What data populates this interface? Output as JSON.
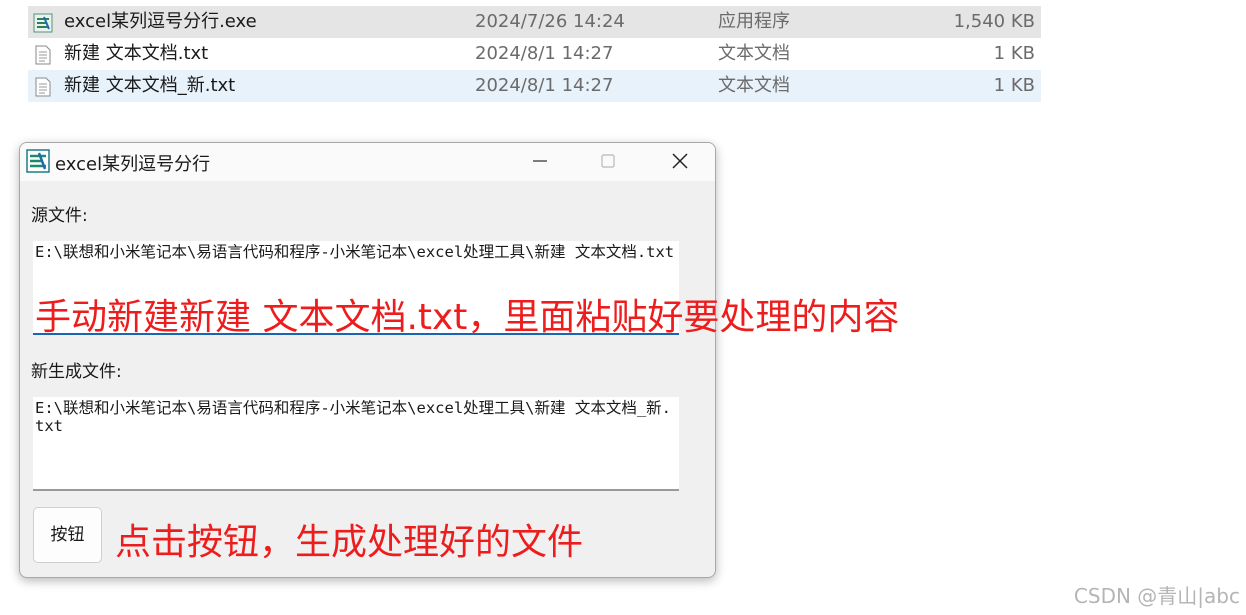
{
  "explorer": {
    "files": [
      {
        "name": "excel某列逗号分行.exe",
        "date": "2024/7/26 14:24",
        "type": "应用程序",
        "size": "1,540 KB",
        "icon": "exe-app-icon"
      },
      {
        "name": "新建 文本文档.txt",
        "date": "2024/8/1 14:27",
        "type": "文本文档",
        "size": "1 KB",
        "icon": "text-file-icon"
      },
      {
        "name": "新建 文本文档_新.txt",
        "date": "2024/8/1 14:27",
        "type": "文本文档",
        "size": "1 KB",
        "icon": "text-file-icon"
      }
    ]
  },
  "window": {
    "title": "excel某列逗号分行",
    "source_label": "源文件:",
    "source_path": "E:\\联想和小米笔记本\\易语言代码和程序-小米笔记本\\excel处理工具\\新建 文本文档.txt",
    "output_label": "新生成文件:",
    "output_path": "E:\\联想和小米笔记本\\易语言代码和程序-小米笔记本\\excel处理工具\\新建 文本文档_新.txt",
    "button_label": "按钮",
    "controls": {
      "minimize": "minimize-icon",
      "maximize": "maximize-icon",
      "close": "close-icon"
    }
  },
  "annotations": {
    "source_note": "手动新建新建 文本文档.txt，里面粘贴好要处理的内容",
    "button_note": "点击按钮，生成处理好的文件",
    "color": "#ee1d1d"
  },
  "watermark": "CSDN @青山|abc"
}
